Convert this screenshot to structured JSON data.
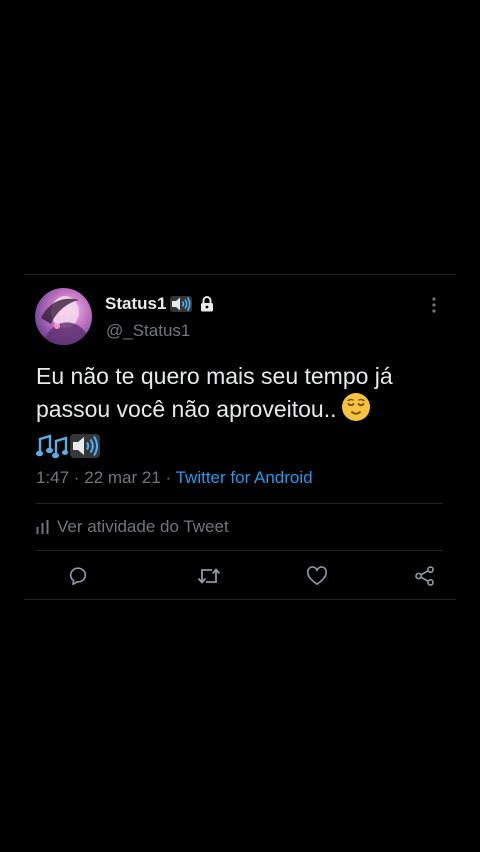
{
  "tweet": {
    "display_name": "Status1",
    "handle": "@_Status1",
    "text_line1": "Eu não te quero mais seu tempo já",
    "text_line2": "passou você não aproveitou..",
    "time": "1:47",
    "date": "22 mar 21",
    "separator": "·",
    "source": "Twitter for Android",
    "activity_label": "Ver atividade do Tweet"
  },
  "icons": {
    "name_badge_1": "speaker-icon",
    "name_badge_2": "lock-icon",
    "more": "more-vertical-icon",
    "text_emoji_1": "relieved-face-emoji",
    "text_emoji_2": "musical-notes-emoji",
    "text_emoji_3": "speaker-emoji",
    "activity": "bar-chart-icon",
    "actions": [
      "reply-icon",
      "retweet-icon",
      "like-icon",
      "share-icon"
    ]
  },
  "colors": {
    "background": "#000000",
    "text_primary": "#e7e9ea",
    "text_secondary": "#71767b",
    "link": "#1d9bf0",
    "divider": "#1f2326"
  }
}
